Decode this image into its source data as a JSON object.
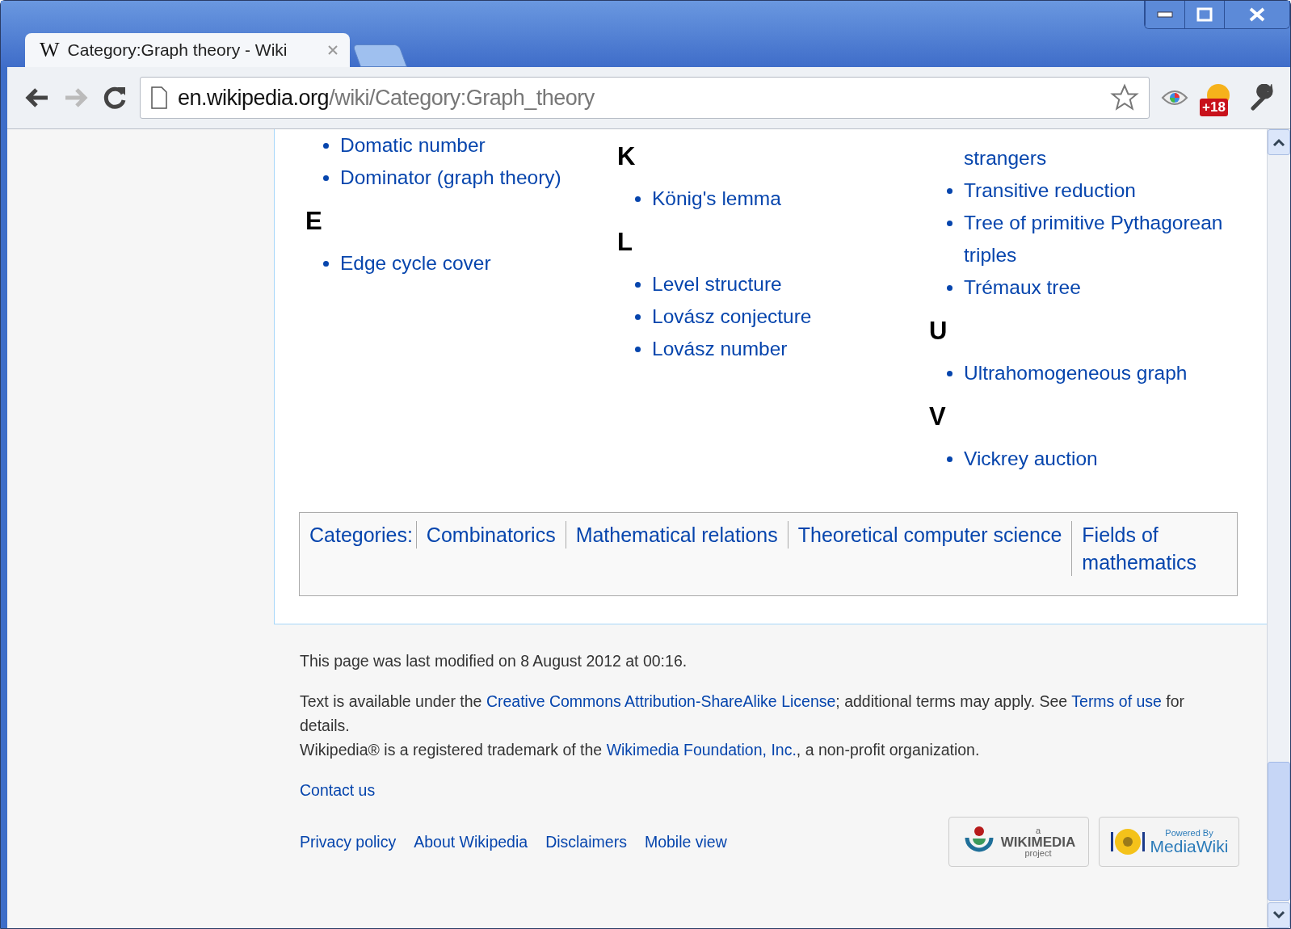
{
  "tab": {
    "favicon": "W",
    "title": "Category:Graph theory - Wiki",
    "selected": true
  },
  "address": {
    "host": "en.wikipedia.org",
    "path": "/wiki/Category:Graph_theory"
  },
  "extension_badge": "+18",
  "columns": [
    {
      "groups": [
        {
          "items": [
            "Domatic number",
            "Dominator (graph theory)"
          ]
        },
        {
          "letter": "E",
          "items": [
            "Edge cycle cover"
          ]
        }
      ]
    },
    {
      "groups": [
        {
          "letter": "K",
          "items": [
            "König's lemma"
          ]
        },
        {
          "letter": "L",
          "items": [
            "Level structure",
            "Lovász conjecture",
            "Lovász number"
          ]
        }
      ]
    },
    {
      "groups": [
        {
          "continued": true,
          "items": [
            "strangers",
            "Transitive reduction",
            "Tree of primitive Pythagorean triples",
            "Trémaux tree"
          ]
        },
        {
          "letter": "U",
          "items": [
            "Ultrahomogeneous graph"
          ]
        },
        {
          "letter": "V",
          "items": [
            "Vickrey auction"
          ]
        }
      ]
    }
  ],
  "categories": {
    "label": "Categories:",
    "links": [
      "Combinatorics",
      "Mathematical relations",
      "Theoretical computer science",
      "Fields of mathematics"
    ]
  },
  "footer": {
    "modified": "This page was last modified on 8 August 2012 at 00:16.",
    "license": [
      {
        "text": "Text is available under the ",
        "link": false
      },
      {
        "text": "Creative Commons Attribution-ShareAlike License",
        "link": true
      },
      {
        "text": "; additional terms may apply. See ",
        "link": false
      },
      {
        "text": "Terms of use",
        "link": true
      },
      {
        "text": " for details.",
        "link": false
      }
    ],
    "trademark": [
      {
        "text": "Wikipedia® is a registered trademark of the ",
        "link": false
      },
      {
        "text": "Wikimedia Foundation, Inc.",
        "link": true
      },
      {
        "text": ", a non-profit organization.",
        "link": false
      }
    ],
    "contact": "Contact us",
    "links": [
      "Privacy policy",
      "About Wikipedia",
      "Disclaimers",
      "Mobile view"
    ],
    "badges": [
      {
        "kind": "wikimedia",
        "top": "a",
        "main": "WIKIMEDIA",
        "bottom": "project"
      },
      {
        "kind": "mediawiki",
        "top": "Powered By",
        "main": "MediaWiki"
      }
    ]
  }
}
